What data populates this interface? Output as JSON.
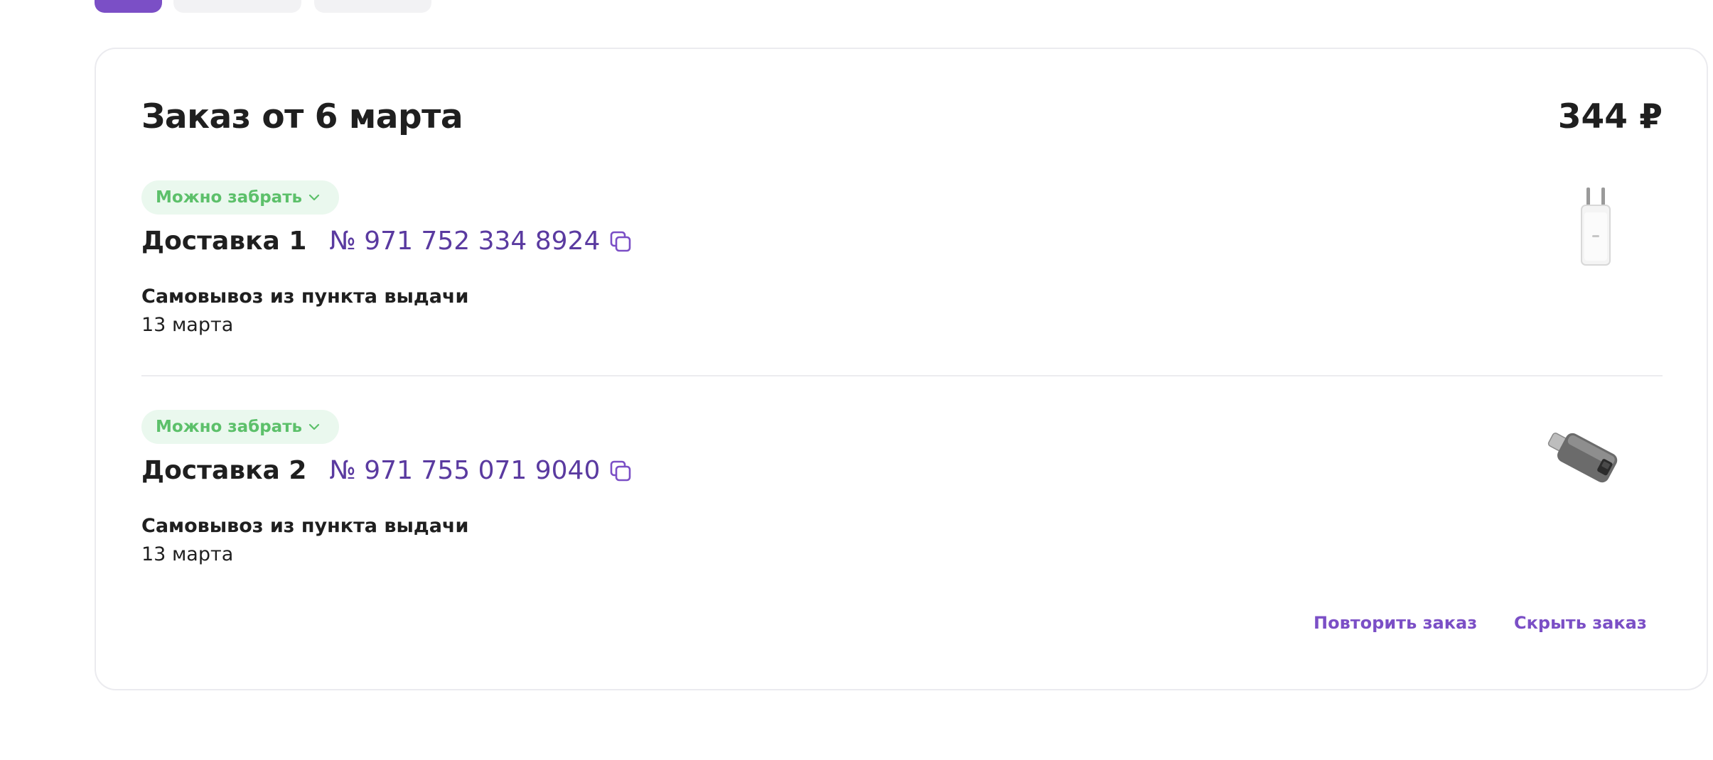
{
  "order": {
    "title": "Заказ от 6 марта",
    "total": "344 ₽",
    "deliveries": [
      {
        "status": "Можно забрать",
        "name": "Доставка 1",
        "tracking": "№ 971 752 334 8924",
        "method": "Самовывоз из пункта выдачи",
        "date": "13 марта",
        "product_icon": "charger-product-image"
      },
      {
        "status": "Можно забрать",
        "name": "Доставка 2",
        "tracking": "№ 971 755 071 9040",
        "method": "Самовывоз из пункта выдачи",
        "date": "13 марта",
        "product_icon": "adapter-product-image"
      }
    ],
    "actions": {
      "repeat": "Повторить заказ",
      "hide": "Скрыть заказ"
    }
  },
  "colors": {
    "accent": "#7b4fc6",
    "tracking": "#5a3aa0",
    "status_text": "#5cc06a",
    "status_bg": "#eaf8ee"
  }
}
